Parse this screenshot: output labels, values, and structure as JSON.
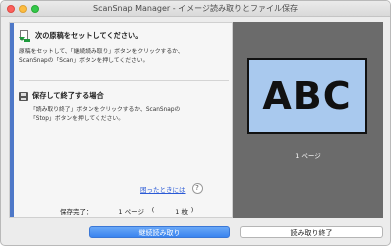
{
  "window": {
    "title": "ScanSnap Manager - イメージ読み取りとファイル保存"
  },
  "step1": {
    "icon": "document-feed-icon",
    "title": "次の原稿をセットしてください。",
    "desc_line1": "原稿をセットして、「継続読み取り」ボタンをクリックするか、",
    "desc_line2": "ScanSnapの「Scan」ボタンを押してください。"
  },
  "step2": {
    "icon": "save-icon",
    "title": "保存して終了する場合",
    "desc_line1": "「読み取り終了」ボタンをクリックするか、ScanSnapの",
    "desc_line2": "「Stop」ボタンを押してください。"
  },
  "help": {
    "link_text": "困ったときには",
    "icon_glyph": "?"
  },
  "status": {
    "label": "保存完了：",
    "pages": "1 ページ",
    "open_paren": "(",
    "sheets": "1 枚",
    "close_paren": ")"
  },
  "preview": {
    "text": "ABC",
    "page_label": "1 ページ",
    "paper_color": "#a9c9ee"
  },
  "buttons": {
    "continue": "継続読み取り",
    "finish": "読み取り終了"
  },
  "colors": {
    "accent_bar": "#4e78c8",
    "primary_button": "#3a84ef",
    "link": "#2a5ad6"
  }
}
